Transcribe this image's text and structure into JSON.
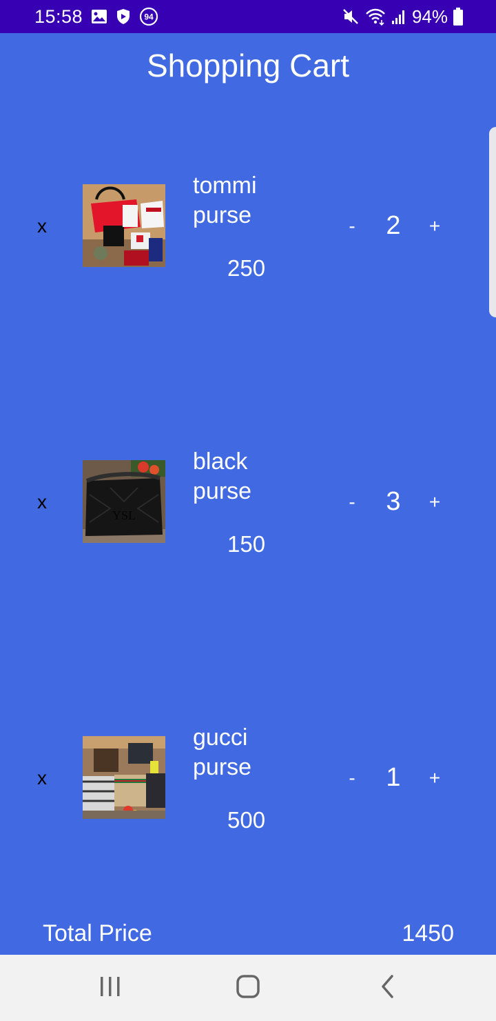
{
  "status_bar": {
    "time": "15:58",
    "battery_percent": "94%",
    "notification_badge": "94",
    "icons": [
      "gallery-icon",
      "shield-icon",
      "notification-count-icon",
      "mute-icon",
      "wifi-icon",
      "signal-icon",
      "battery-icon"
    ]
  },
  "app": {
    "title": "Shopping Cart"
  },
  "cart": {
    "items": [
      {
        "remove_label": "x",
        "name_line1": "tommi",
        "name_line2": "purse",
        "price": "250",
        "minus_label": "-",
        "quantity": "2",
        "plus_label": "+",
        "image": "red-white-purse-photo"
      },
      {
        "remove_label": "x",
        "name_line1": "black",
        "name_line2": "purse",
        "price": "150",
        "minus_label": "-",
        "quantity": "3",
        "plus_label": "+",
        "image": "black-quilted-purse-photo"
      },
      {
        "remove_label": "x",
        "name_line1": "gucci",
        "name_line2": "purse",
        "price": "500",
        "minus_label": "-",
        "quantity": "1",
        "plus_label": "+",
        "image": "patterned-purses-photo"
      }
    ]
  },
  "total": {
    "label": "Total Price",
    "value": "1450"
  },
  "nav_bar": {
    "buttons": [
      "recents-icon",
      "home-icon",
      "back-icon"
    ]
  },
  "colors": {
    "background": "#4169E1",
    "status_bar": "#3700B3",
    "nav_bar": "#F2F2F2",
    "remove_text": "#000000",
    "text": "#FFFFFF"
  }
}
